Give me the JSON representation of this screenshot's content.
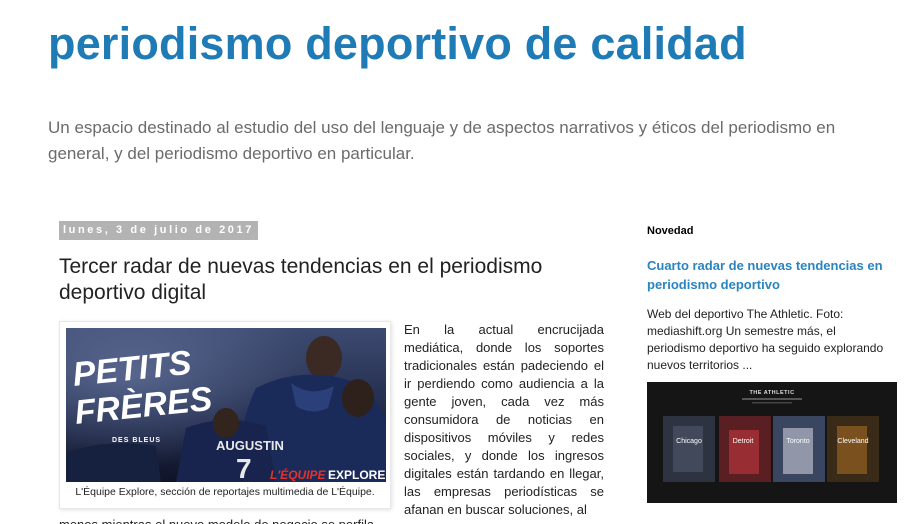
{
  "header": {
    "title": "periodismo deportivo de calidad",
    "description": "Un espacio destinado al estudio del uso del lenguaje y de aspectos narrativos y éticos del periodismo en general, y del periodismo deportivo en particular."
  },
  "post": {
    "date": "lunes, 3 de julio de 2017",
    "title": "Tercer radar de nuevas tendencias en el periodismo deportivo digital",
    "image": {
      "poster_line1": "PETITS",
      "poster_line2": "FRÈRES",
      "poster_tag": "DES BLEUS",
      "jersey_name": "AUGUSTIN",
      "jersey_number": "7",
      "brand": "L'ÉQUIPE",
      "brand_suffix": "EXPLORE",
      "caption": "L'Équipe Explore, sección de reportajes multimedia de L'Équipe."
    },
    "body": "En la actual encrucijada mediática, donde los soportes tradicionales están padeciendo el ir perdiendo como audiencia a la gente joven, cada vez más consumidora de noticias en dispositivos móviles y redes sociales, y donde los ingresos digitales están tardando en llegar, las empresas periodísticas se afanan en buscar soluciones, al",
    "body_continued": "menos mientras el nuevo modelo de negocio se perfila."
  },
  "sidebar": {
    "heading": "Novedad",
    "post_title": "Cuarto radar de nuevas tendencias en periodismo deportivo",
    "snippet": "Web del deportivo The Athletic. Foto: mediashift.org Un semestre más, el periodismo deportivo ha seguido explorando nuevos territorios ...",
    "thumb": {
      "brand": "THE ATHLETIC",
      "cities": [
        "Chicago",
        "Detroit",
        "Toronto",
        "Cleveland"
      ]
    }
  },
  "colors": {
    "title": "#1f7bb5",
    "link": "#2a84c0",
    "date_bg": "#b3b3b3",
    "description": "#6b6b6b"
  }
}
